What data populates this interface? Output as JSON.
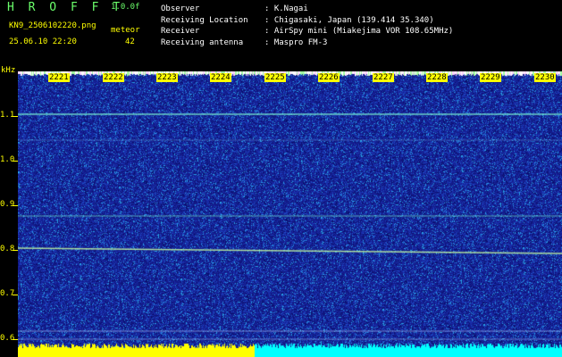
{
  "header": {
    "app_title": "H R O F F T",
    "version": "1.0.0f",
    "filename": "KN9_2506102220.png",
    "mode": "meteor",
    "count": "42",
    "datetime": "25.06.10 22:20"
  },
  "info": {
    "labels": [
      "Observer",
      "Receiving Location",
      "Receiver",
      "Receiving antenna"
    ],
    "values": [
      ": K.Nagai",
      ": Chigasaki, Japan (139.414 35.340)",
      ": AirSpy mini (Miakejima VOR 108.65MHz)",
      ": Maspro FM-3"
    ]
  },
  "y_axis": {
    "unit": "kHz",
    "ticks": [
      "1.1",
      "1.0",
      "0.9",
      "0.8",
      "0.7",
      "0.6"
    ]
  },
  "time_axis": {
    "ticks": [
      "2221",
      "2222",
      "2223",
      "2224",
      "2225",
      "2226",
      "2227",
      "2228",
      "2229",
      "2230"
    ]
  },
  "colors": {
    "background": "#141c8c",
    "header_green": "#6bff6b",
    "label_yellow": "#ffff00",
    "signal_cyan": "#7fffd4",
    "bottom_cyan": "#00ffff"
  }
}
